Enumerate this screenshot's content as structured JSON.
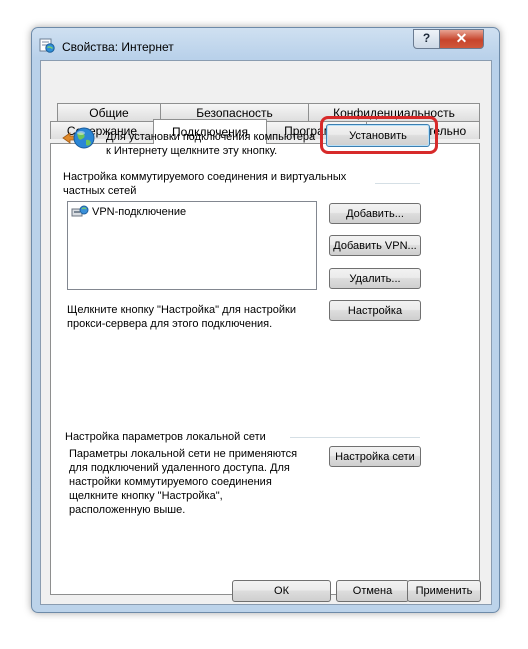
{
  "window": {
    "title": "Свойства: Интернет",
    "help_label": "?",
    "close_label": "✕"
  },
  "tabs": {
    "row1": [
      "Общие",
      "Безопасность",
      "Конфиденциальность"
    ],
    "row2": [
      "Содержание",
      "Подключения",
      "Программы",
      "Дополнительно"
    ],
    "active": "Подключения"
  },
  "setup": {
    "text_line1": "Для установки подключения компьютера",
    "text_line2": "к Интернету щелкните эту кнопку.",
    "button_label": "Установить"
  },
  "vpn": {
    "heading_line1": "Настройка коммутируемого соединения и виртуальных",
    "heading_line2": "частных сетей",
    "connections": [
      "VPN-подключение"
    ],
    "add_label": "Добавить...",
    "add_vpn_label": "Добавить VPN...",
    "remove_label": "Удалить...",
    "proxy_text_line1": "Щелкните кнопку \"Настройка\" для настройки",
    "proxy_text_line2": "прокси-сервера для этого подключения.",
    "settings_label": "Настройка"
  },
  "lan": {
    "heading": "Настройка параметров локальной сети",
    "text_line1": "Параметры локальной сети не применяются",
    "text_line2": "для подключений удаленного доступа. Для",
    "text_line3": "настройки коммутируемого соединения",
    "text_line4": "щелкните кнопку \"Настройка\",",
    "text_line5": "расположенную выше.",
    "button_label": "Настройка сети"
  },
  "footer": {
    "ok_label": "ОК",
    "cancel_label": "Отмена",
    "apply_label": "Применить"
  },
  "colors": {
    "highlight": "#d72a2a",
    "titlebar": "#b9d1ea",
    "close_button": "#c7452c"
  }
}
